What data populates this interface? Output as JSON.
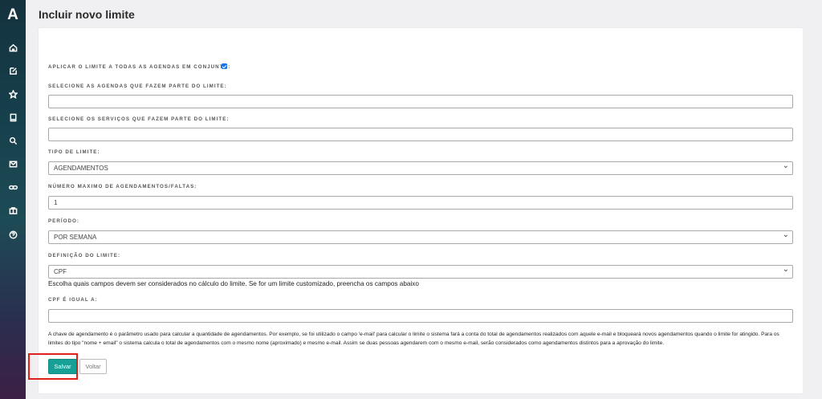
{
  "sidebar": {
    "logo": "A",
    "items": [
      {
        "icon": "home-icon"
      },
      {
        "icon": "edit-icon"
      },
      {
        "icon": "star-icon"
      },
      {
        "icon": "book-icon"
      },
      {
        "icon": "search-icon"
      },
      {
        "icon": "mail-icon"
      },
      {
        "icon": "link-icon"
      },
      {
        "icon": "briefcase-icon"
      },
      {
        "icon": "help-icon"
      }
    ]
  },
  "page": {
    "title": "Incluir novo limite"
  },
  "form": {
    "apply_all_label": "APLICAR O LIMITE A TODAS AS AGENDAS EM CONJUNTO:",
    "apply_all_checked": true,
    "agendas_label": "SELECIONE AS AGENDAS QUE FAZEM PARTE DO LIMITE:",
    "agendas_value": "",
    "services_label": "SELECIONE OS SERVIÇOS QUE FAZEM PARTE DO LIMITE:",
    "services_value": "",
    "limit_type_label": "TIPO DE LIMITE:",
    "limit_type_value": "AGENDAMENTOS",
    "max_label": "NÚMERO MAXIMO DE AGENDAMENTOS/FALTAS:",
    "max_value": "1",
    "period_label": "PERÍODO:",
    "period_value": "POR SEMANA",
    "definition_label": "DEFINIÇÃO DO LIMITE:",
    "definition_value": "CPF",
    "definition_help": "Escolha quais campos devem ser considerados no cálculo do limite. Se for um limite customizado, preencha os campos abaixo",
    "cpf_label": "CPF É IGUAL A:",
    "cpf_value": "",
    "note": "A chave de agendamento é o parâmetro usado para calcular a quantidade de agendamentos. Por exemplo, se foi utilizado o campo 'e-mail' para calcular o limite o sistema fará a conta do total de agendamentos realizados com aquele e-mail e bloqueará novos agendamentos quando o limite for atingido. Para os limites do tipo \"nome + email\" o sistema calcula o total de agendamentos com o mesmo nome (aproximado) e mesmo e-mail. Assim se duas pessoas agendarem com o mesmo e-mail, serão considerados como agendamentos distintos para a aprovação do limite."
  },
  "buttons": {
    "save": "Salvar",
    "back": "Voltar"
  },
  "colors": {
    "save_button": "#17a096",
    "highlight": "#e0201c",
    "checkbox": "#1a73e8"
  }
}
